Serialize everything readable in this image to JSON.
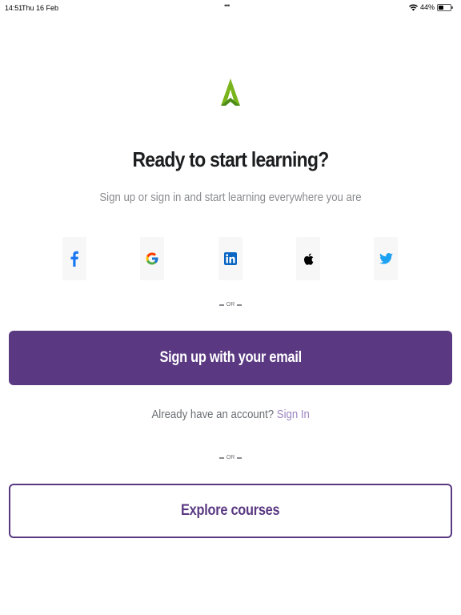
{
  "status_bar": {
    "time": "14:51",
    "date": "Thu 16 Feb",
    "dots": "•••",
    "battery": "44%",
    "battery_level": 0.44
  },
  "logo": {
    "icon": "brand-triangle-logo",
    "colors": [
      "#78b51e",
      "#4c8b1a"
    ]
  },
  "header": {
    "title": "Ready to start learning?",
    "subtitle": "Sign up or sign in and start learning everywhere you are"
  },
  "social": [
    {
      "name": "facebook",
      "icon": "facebook-icon",
      "color": "#1877f2"
    },
    {
      "name": "google",
      "icon": "google-icon",
      "color": "#4285f4"
    },
    {
      "name": "linkedin",
      "icon": "linkedin-icon",
      "color": "#0a66c2"
    },
    {
      "name": "apple",
      "icon": "apple-icon",
      "color": "#000000"
    },
    {
      "name": "twitter",
      "icon": "twitter-icon",
      "color": "#1da1f2"
    }
  ],
  "separator": {
    "label": "OR"
  },
  "signup": {
    "label": "Sign up with your email",
    "color": "#5a3982"
  },
  "account": {
    "prompt": "Already have an account?",
    "link": "Sign In"
  },
  "explore": {
    "label": "Explore courses"
  }
}
